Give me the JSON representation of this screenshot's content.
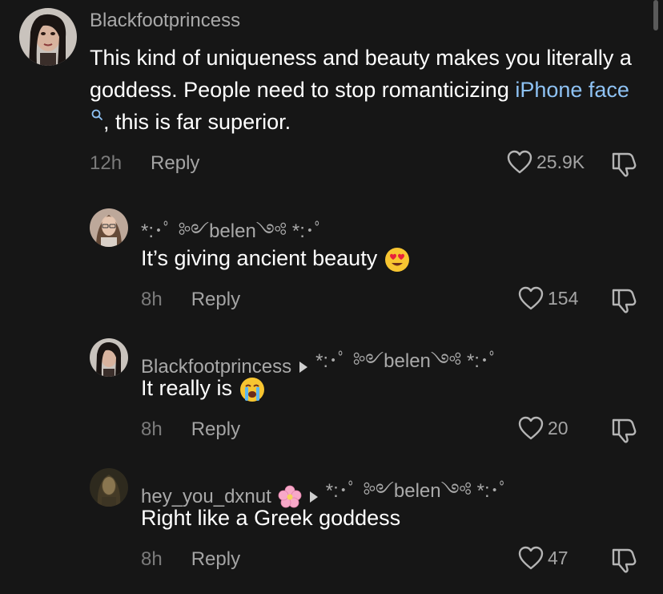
{
  "comments": [
    {
      "username": "Blackfootprincess",
      "text_before": "This kind of uniqueness and beauty makes you literally a goddess. People need to stop romanticizing ",
      "link": "iPhone face",
      "text_after": ", this is far superior.",
      "time": "12h",
      "reply_label": "Reply",
      "likes": "25.9K"
    },
    {
      "username": "*:･ﾟ ༻belen༺ *:･ﾟ",
      "text": "It’s giving ancient beauty",
      "emoji": "heart-eyes-emoji",
      "time": "8h",
      "reply_label": "Reply",
      "likes": "154"
    },
    {
      "username": "Blackfootprincess",
      "reply_to": "*:･ﾟ ༻belen༺ *:･ﾟ",
      "text": "It really is",
      "emoji": "loudly-crying-emoji",
      "time": "8h",
      "reply_label": "Reply",
      "likes": "20"
    },
    {
      "username": "hey_you_dxnut",
      "username_emoji": "cherry-blossom-emoji",
      "reply_to": "*:･ﾟ ༻belen༺ *:･ﾟ",
      "text": "Right like a Greek goddess",
      "time": "8h",
      "reply_label": "Reply",
      "likes": "47"
    }
  ],
  "colors": {
    "background": "#161616",
    "link": "#8ec2f4",
    "muted": "#a4a4a4"
  }
}
